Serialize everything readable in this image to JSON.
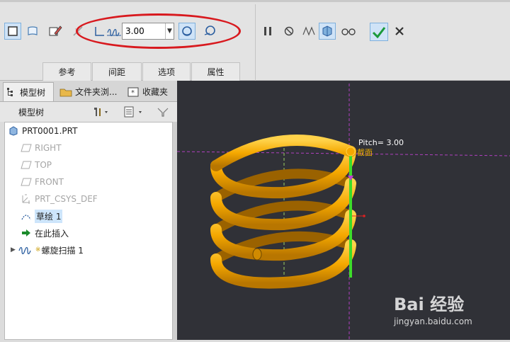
{
  "ribbon": {
    "pitch_value": "3.00",
    "tabs": [
      "参考",
      "间距",
      "选项",
      "属性"
    ]
  },
  "panel": {
    "tabs": [
      "模型树",
      "文件夹浏...",
      "收藏夹"
    ],
    "tree_header": "模型树"
  },
  "tree": {
    "items": [
      {
        "label": "PRT0001.PRT",
        "icon": "part-icon"
      },
      {
        "label": "RIGHT",
        "icon": "datum-plane-icon"
      },
      {
        "label": "TOP",
        "icon": "datum-plane-icon"
      },
      {
        "label": "FRONT",
        "icon": "datum-plane-icon"
      },
      {
        "label": "PRT_CSYS_DEF",
        "icon": "csys-icon"
      },
      {
        "label": "草绘 1",
        "icon": "sketch-icon"
      },
      {
        "label": "在此插入",
        "icon": "insert-arrow-icon"
      },
      {
        "label": "螺旋扫描 1",
        "icon": "helical-sweep-icon"
      }
    ]
  },
  "viewport": {
    "pitch_label": "Pitch= 3.00",
    "section_label": "截面"
  },
  "watermark": {
    "brand": "Bai 经验",
    "url": "jingyan.baidu.com"
  },
  "colors": {
    "spring": "#f5a800",
    "viewport_bg": "#303137",
    "highlight_green": "#3ddc2a",
    "annotation_red": "#d8191e"
  }
}
